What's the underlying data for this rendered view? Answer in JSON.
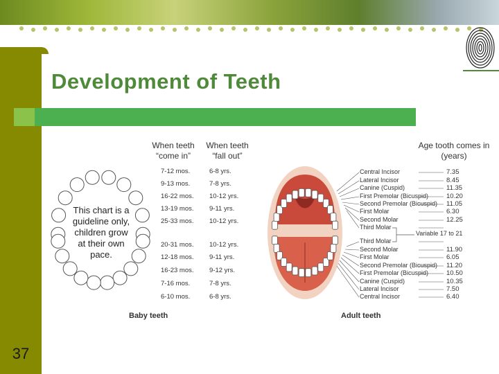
{
  "slide": {
    "title": "Development of Teeth",
    "page_number": "37"
  },
  "baby_chart": {
    "header_in": "When teeth “come in”",
    "header_out": "When teeth “fall out”",
    "note": "This chart is a guideline only, children grow at their own pace.",
    "caption": "Baby teeth",
    "upper_rows": [
      {
        "come_in": "7-12 mos.",
        "fall_out": "6-8 yrs."
      },
      {
        "come_in": "9-13 mos.",
        "fall_out": "7-8 yrs."
      },
      {
        "come_in": "16-22 mos.",
        "fall_out": "10-12 yrs."
      },
      {
        "come_in": "13-19 mos.",
        "fall_out": "9-11 yrs."
      },
      {
        "come_in": "25-33 mos.",
        "fall_out": "10-12 yrs."
      }
    ],
    "lower_rows": [
      {
        "come_in": "20-31 mos.",
        "fall_out": "10-12 yrs."
      },
      {
        "come_in": "12-18 mos.",
        "fall_out": "9-11 yrs."
      },
      {
        "come_in": "16-23 mos.",
        "fall_out": "9-12 yrs."
      },
      {
        "come_in": "7-16 mos.",
        "fall_out": "7-8 yrs."
      },
      {
        "come_in": "6-10 mos.",
        "fall_out": "6-8 yrs."
      }
    ]
  },
  "adult_chart": {
    "header_age": "Age tooth comes in (years)",
    "caption": "Adult teeth",
    "variable_label": "Variable 17 to 21",
    "upper_rows": [
      {
        "tooth": "Central Incisor",
        "age": "7.35"
      },
      {
        "tooth": "Lateral Incisor",
        "age": "8.45"
      },
      {
        "tooth": "Canine (Cuspid)",
        "age": "11.35"
      },
      {
        "tooth": "First Premolar (Bicuspid)",
        "age": "10.20"
      },
      {
        "tooth": "Second Premolar (Bicuspid)",
        "age": "11.05"
      },
      {
        "tooth": "First Molar",
        "age": "6.30"
      },
      {
        "tooth": "Second Molar",
        "age": "12.25"
      },
      {
        "tooth": "Third Molar",
        "age": ""
      }
    ],
    "lower_rows": [
      {
        "tooth": "Third Molar",
        "age": ""
      },
      {
        "tooth": "Second Molar",
        "age": "11.90"
      },
      {
        "tooth": "First Molar",
        "age": "6.05"
      },
      {
        "tooth": "Second Premolar (Bicuspid)",
        "age": "11.20"
      },
      {
        "tooth": "First Premolar (Bicuspid)",
        "age": "10.50"
      },
      {
        "tooth": "Canine (Cuspid)",
        "age": "10.35"
      },
      {
        "tooth": "Lateral Incisor",
        "age": "7.50"
      },
      {
        "tooth": "Central Incisor",
        "age": "6.40"
      }
    ]
  },
  "colors": {
    "sidebar": "#858a00",
    "title": "#4f8a3a",
    "title_bar": "#4caf50",
    "accent_square": "#8bc34a"
  },
  "icons": [
    "fingerprint-icon",
    "baby-teeth-diagram",
    "adult-mouth-diagram"
  ]
}
